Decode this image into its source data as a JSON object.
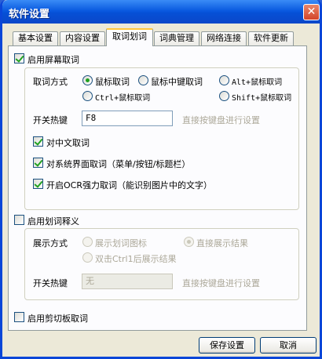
{
  "window": {
    "title": "软件设置",
    "close_glyph": "✕"
  },
  "tabs": [
    {
      "label": "基本设置"
    },
    {
      "label": "内容设置"
    },
    {
      "label": "取词划词"
    },
    {
      "label": "词典管理"
    },
    {
      "label": "网络连接"
    },
    {
      "label": "软件更新"
    }
  ],
  "screen_capture": {
    "enable_label": "启用屏幕取词",
    "enabled": true,
    "method_label": "取词方式",
    "methods": [
      {
        "label": "鼠标取词",
        "selected": true
      },
      {
        "label": "鼠标中键取词",
        "selected": false
      },
      {
        "label": "Alt+鼠标取词",
        "selected": false
      },
      {
        "label": "Ctrl+鼠标取词",
        "selected": false
      },
      {
        "label": "Shift+鼠标取词",
        "selected": false
      }
    ],
    "hotkey_label": "开关热键",
    "hotkey_value": "F8",
    "hotkey_hint": "直接按键盘进行设置",
    "options": [
      {
        "label": "对中文取词",
        "checked": true
      },
      {
        "label": "对系统界面取词（菜单/按钮/标题栏）",
        "checked": true
      },
      {
        "label": "开启OCR强力取词（能识别图片中的文字）",
        "checked": true
      }
    ]
  },
  "selection_translate": {
    "enable_label": "启用划词释义",
    "enabled": false,
    "display_label": "展示方式",
    "modes": [
      {
        "label": "展示划词图标",
        "selected": false
      },
      {
        "label": "直接展示结果",
        "selected": true
      },
      {
        "label": "双击Ctrl1后展示结果",
        "selected": false
      }
    ],
    "hotkey_label": "开关热键",
    "hotkey_value": "无",
    "hotkey_hint": "直接按键盘进行设置"
  },
  "clipboard": {
    "enable_label": "启用剪切板取词",
    "enabled": false
  },
  "buttons": {
    "save": "保存设置",
    "cancel": "取消"
  }
}
